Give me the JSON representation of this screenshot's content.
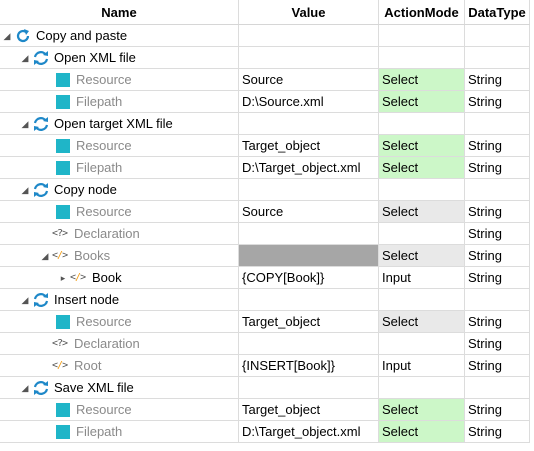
{
  "columns": {
    "name": "Name",
    "value": "Value",
    "action": "ActionMode",
    "type": "DataType"
  },
  "colors": {
    "select_green": "#ccf7c8",
    "icon_teal": "#1fb5c8",
    "refresh_blue": "#1e88c8"
  },
  "rows": [
    {
      "name": "Copy and paste",
      "value": "",
      "action": "",
      "type": ""
    },
    {
      "name": "Open XML file",
      "value": "",
      "action": "",
      "type": ""
    },
    {
      "name": "Resource",
      "value": "Source",
      "action": "Select",
      "type": "String"
    },
    {
      "name": "Filepath",
      "value": "D:\\Source.xml",
      "action": "Select",
      "type": "String"
    },
    {
      "name": "Open target XML file",
      "value": "",
      "action": "",
      "type": ""
    },
    {
      "name": "Resource",
      "value": "Target_object",
      "action": "Select",
      "type": "String"
    },
    {
      "name": "Filepath",
      "value": "D:\\Target_object.xml",
      "action": "Select",
      "type": "String"
    },
    {
      "name": "Copy node",
      "value": "",
      "action": "",
      "type": ""
    },
    {
      "name": "Resource",
      "value": "Source",
      "action": "Select",
      "type": "String"
    },
    {
      "name": "Declaration",
      "value": "",
      "action": "",
      "type": "String"
    },
    {
      "name": "Books",
      "value": "",
      "action": "Select",
      "type": "String"
    },
    {
      "name": "Book",
      "value": "{COPY[Book]}",
      "action": "Input",
      "type": "String"
    },
    {
      "name": "Insert node",
      "value": "",
      "action": "",
      "type": ""
    },
    {
      "name": "Resource",
      "value": "Target_object",
      "action": "Select",
      "type": "String"
    },
    {
      "name": "Declaration",
      "value": "",
      "action": "",
      "type": "String"
    },
    {
      "name": "Root",
      "value": "{INSERT[Book]}",
      "action": "Input",
      "type": "String"
    },
    {
      "name": "Save XML file",
      "value": "",
      "action": "",
      "type": ""
    },
    {
      "name": "Resource",
      "value": "Target_object",
      "action": "Select",
      "type": "String"
    },
    {
      "name": "Filepath",
      "value": "D:\\Target_object.xml",
      "action": "Select",
      "type": "String"
    }
  ]
}
